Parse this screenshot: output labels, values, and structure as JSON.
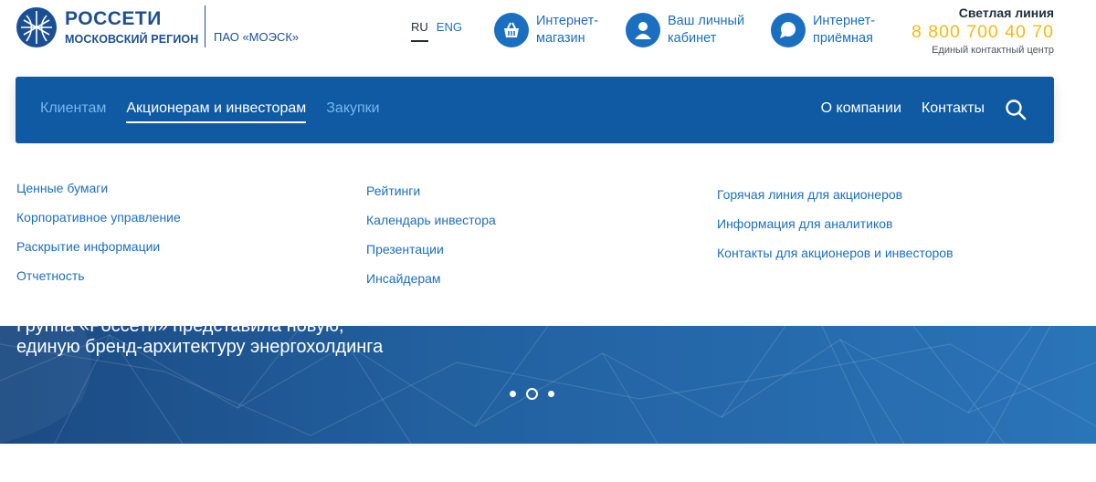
{
  "header": {
    "logo": {
      "title": "РОССЕТИ",
      "subtitle": "МОСКОВСКИЙ РЕГИОН"
    },
    "company": "ПАО «МОЭСК»",
    "languages": [
      {
        "code": "RU",
        "active": true
      },
      {
        "code": "ENG",
        "active": false
      }
    ],
    "quick_links": [
      {
        "label": "Интернет-\nмагазин",
        "icon": "basket-icon"
      },
      {
        "label": "Ваш личный\nкабинет",
        "icon": "user-icon"
      },
      {
        "label": "Интернет-\nприёмная",
        "icon": "chat-icon"
      }
    ],
    "hotline": {
      "title": "Светлая линия",
      "phone": "8 800 700 40 70",
      "subtitle": "Единый контактный центр"
    }
  },
  "nav": {
    "left": [
      {
        "label": "Клиентам",
        "active": false
      },
      {
        "label": "Акционерам и инвесторам",
        "active": true
      },
      {
        "label": "Закупки",
        "active": false
      }
    ],
    "right": [
      {
        "label": "О компании"
      },
      {
        "label": "Контакты"
      }
    ],
    "search_icon": "search-icon"
  },
  "dropdown": {
    "columns": [
      {
        "items": [
          "Ценные бумаги",
          "Корпоративное управление",
          "Раскрытие информации",
          "Отчетность"
        ]
      },
      {
        "items": [
          "Рейтинги",
          "Календарь инвестора",
          "Презентации",
          "Инсайдерам"
        ]
      },
      {
        "items": [
          "Горячая линия для акционеров",
          "Информация для аналитиков",
          "Контакты для акционеров и инвесторов"
        ]
      }
    ]
  },
  "banner": {
    "text_partial": "Группа «Россети» представила новую,",
    "text": "единую бренд-архитектуру энергохолдинга",
    "slides_count": 3,
    "active_slide": 2
  },
  "colors": {
    "brand_blue": "#1b4f95",
    "link_blue": "#1b6fc0",
    "nav_blue": "#0f5aa3",
    "phone_yellow": "#f6b90e"
  }
}
